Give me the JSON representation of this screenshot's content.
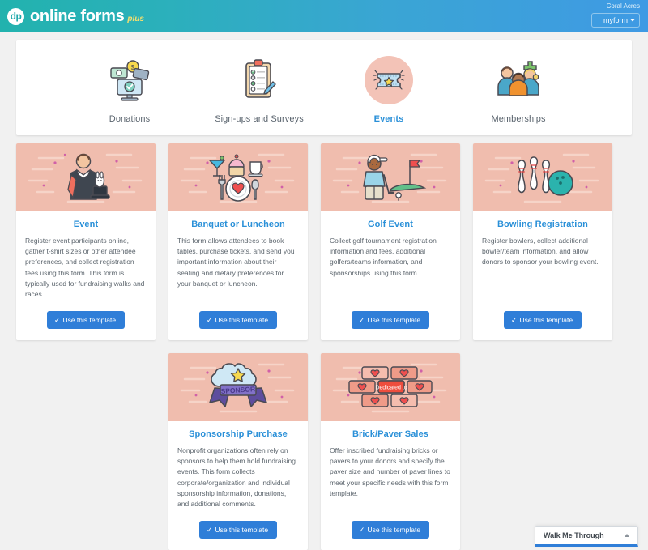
{
  "header": {
    "logo_text": "dp",
    "brand_name": "online forms",
    "brand_suffix": "plus",
    "account_name": "Coral Acres",
    "form_select_value": "myform",
    "caret_icon": "chevron-down-icon",
    "gradient_from": "#22b2ae",
    "gradient_to": "#3f9ae4"
  },
  "nav": {
    "items": [
      {
        "label": "Donations",
        "icon": "donations-illustration",
        "active": false
      },
      {
        "label": "Sign-ups and Surveys",
        "icon": "clipboard-survey-illustration",
        "active": false
      },
      {
        "label": "Events",
        "icon": "event-ticket-illustration",
        "active": true
      },
      {
        "label": "Memberships",
        "icon": "memberships-people-illustration",
        "active": false
      }
    ],
    "active_color": "#2a90d8",
    "inactive_color": "#59636d",
    "active_circle_color": "#f3c3b7"
  },
  "templates": {
    "button_label": "Use this template",
    "button_icon": "check-icon",
    "button_color": "#2f7ed8",
    "art_bg_color": "#f0bdae",
    "cards": [
      {
        "title": "Event",
        "icon": "magician-illustration",
        "description": "Register event participants online, gather t-shirt sizes or other attendee preferences, and collect registration fees using this form. This form is typically used for fundraising walks and races."
      },
      {
        "title": "Banquet or Luncheon",
        "icon": "dinner-plate-illustration",
        "description": "This form allows attendees to book tables, purchase tickets, and send you important information about their seating and dietary preferences for your banquet or luncheon."
      },
      {
        "title": "Golf Event",
        "icon": "golfer-illustration",
        "description": "Collect golf tournament registration information and fees, additional golfers/teams information, and sponsorships using this form."
      },
      {
        "title": "Bowling Registration",
        "icon": "bowling-pins-illustration",
        "description": "Register bowlers, collect additional bowler/team information, and allow donors to sponsor your bowling event."
      },
      {
        "title": "Sponsorship Purchase",
        "icon": "sponsor-ribbon-illustration",
        "description": "Nonprofit organizations often rely on sponsors to help them hold fundraising events. This form collects corporate/organization and individual sponsorship information, donations, and additional comments."
      },
      {
        "title": "Brick/Paver Sales",
        "icon": "brick-wall-illustration",
        "description": "Offer inscribed fundraising bricks or pavers to your donors and specify the paver size and number of paver lines to meet your specific needs with this form template.",
        "art_label": "Dedicated to"
      }
    ]
  },
  "walk_me_through": {
    "label": "Walk Me Through",
    "caret_icon": "chevron-up-icon",
    "accent_color": "#2f7ed8"
  }
}
